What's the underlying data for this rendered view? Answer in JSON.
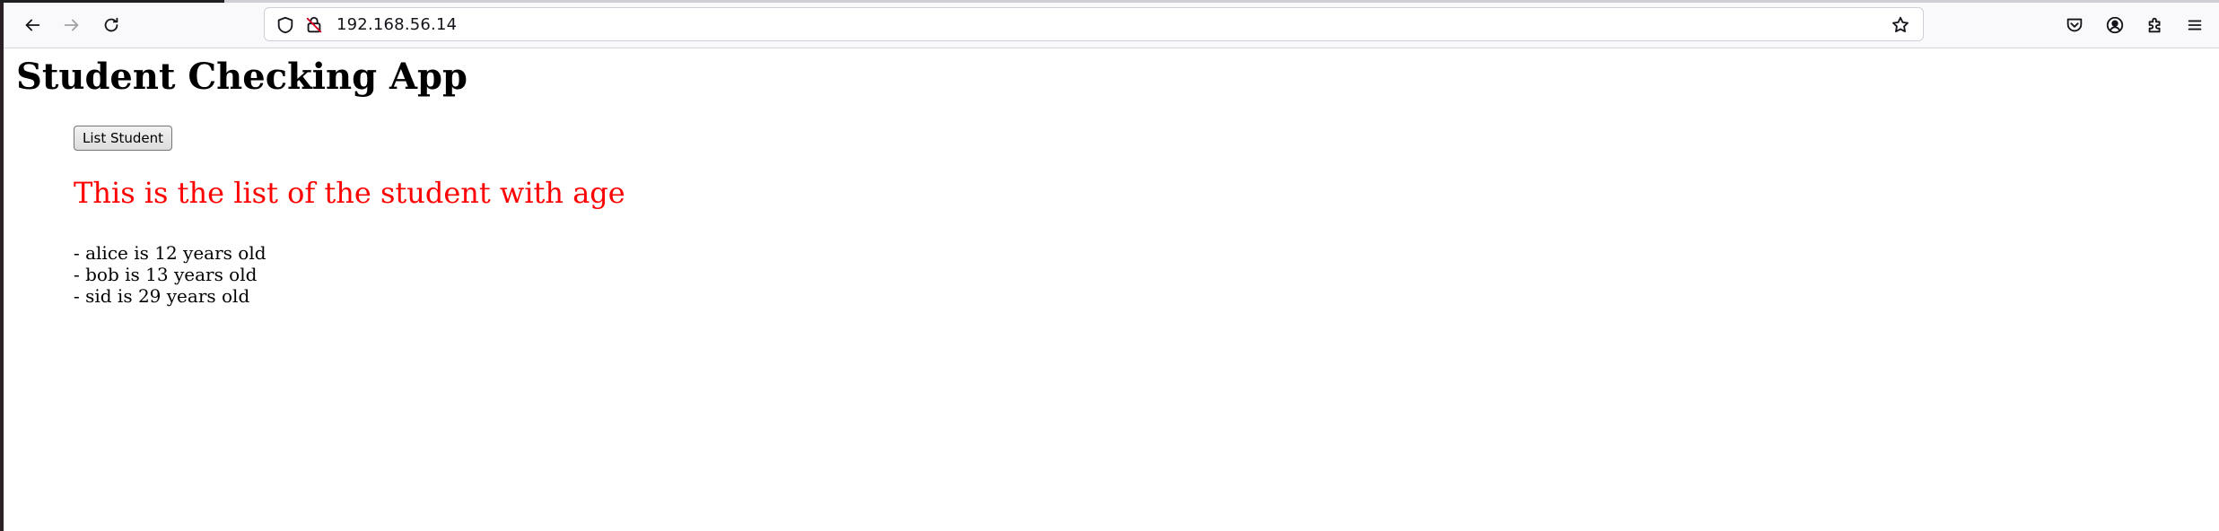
{
  "browser": {
    "url": "192.168.56.14",
    "icons": {
      "back": "back-arrow-icon",
      "forward": "forward-arrow-icon",
      "reload": "reload-icon",
      "tracking": "shield-icon",
      "insecure": "insecure-lock-icon",
      "bookmark": "star-icon",
      "pocket": "pocket-icon",
      "account": "account-icon",
      "extensions": "extensions-icon",
      "menu": "hamburger-menu-icon"
    }
  },
  "page": {
    "title": "Student Checking App",
    "button_label": "List Student",
    "list_heading": "This is the list of the student with age",
    "heading_color": "#ff0000",
    "students": [
      "- alice is 12 years old",
      "- bob is 13 years old",
      "- sid is 29 years old"
    ]
  }
}
